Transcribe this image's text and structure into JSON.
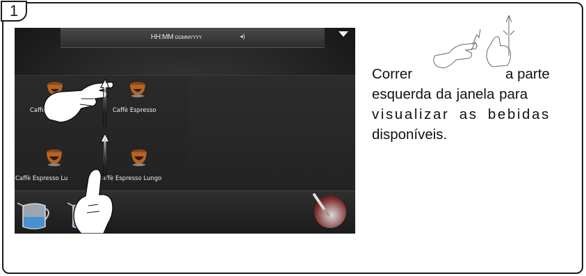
{
  "step": {
    "number": "1"
  },
  "statusbar": {
    "time": "HH:MM",
    "date": "GGMMYYYY",
    "speaker_icon": "speaker-icon",
    "menu_icon": "chevron-down-icon"
  },
  "drinks": [
    {
      "label": "Caffè Espresso",
      "visible_label": "Caffè E"
    },
    {
      "label": "Caffè Espresso"
    },
    {
      "label": "Caffè Espresso Lungo",
      "visible_label": "Caffè Espresso Lu"
    },
    {
      "label": "Caffè Espresso Lungo",
      "visible_label": "affè Espresso Lungo"
    }
  ],
  "instruction": {
    "word_before": "Correr",
    "word_after": "a parte",
    "line2": "esquerda da janela para",
    "line3": "visualizar as bebidas",
    "line4": "disponíveis."
  },
  "colors": {
    "screen_bg": "#262626",
    "text": "#111111",
    "label": "#f0f0f0"
  }
}
